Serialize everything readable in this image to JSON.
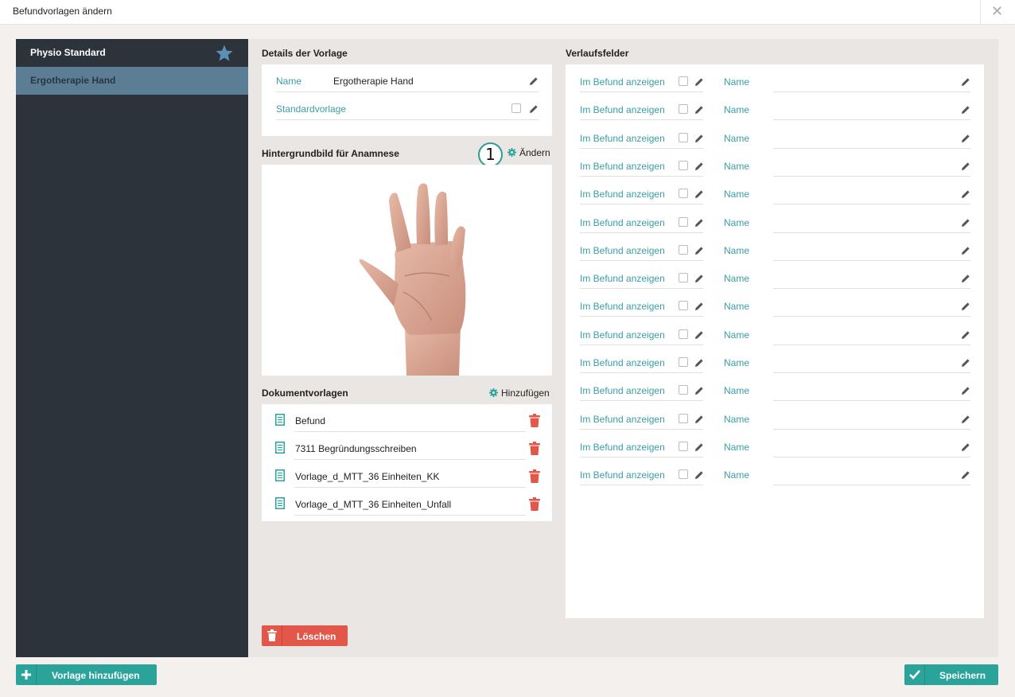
{
  "window": {
    "title": "Befundvorlagen ändern"
  },
  "sidebar": {
    "items": [
      {
        "label": "Physio Standard",
        "starred": true
      },
      {
        "label": "Ergotherapie Hand",
        "selected": true
      }
    ]
  },
  "details": {
    "title": "Details der Vorlage",
    "name_label": "Name",
    "name_value": "Ergotherapie Hand",
    "standard_label": "Standardvorlage"
  },
  "background": {
    "title": "Hintergrundbild für Anamnese",
    "change_label": "Ändern",
    "badge": "1"
  },
  "documents": {
    "title": "Dokumentvorlagen",
    "add_label": "Hinzufügen",
    "items": [
      "Befund",
      "7311 Begründungsschreiben",
      "Vorlage_d_MTT_36 Einheiten_KK",
      "Vorlage_d_MTT_36 Einheiten_Unfall"
    ]
  },
  "delete_button": "Löschen",
  "verlauf": {
    "title": "Verlaufsfelder",
    "rows": [
      {
        "show_label": "Im Befund anzeigen",
        "name_label": "Name"
      },
      {
        "show_label": "Im Befund anzeigen",
        "name_label": "Name"
      },
      {
        "show_label": "Im Befund anzeigen",
        "name_label": "Name"
      },
      {
        "show_label": "Im Befund anzeigen",
        "name_label": "Name"
      },
      {
        "show_label": "Im Befund anzeigen",
        "name_label": "Name"
      },
      {
        "show_label": "Im Befund anzeigen",
        "name_label": "Name"
      },
      {
        "show_label": "Im Befund anzeigen",
        "name_label": "Name"
      },
      {
        "show_label": "Im Befund anzeigen",
        "name_label": "Name"
      },
      {
        "show_label": "Im Befund anzeigen",
        "name_label": "Name"
      },
      {
        "show_label": "Im Befund anzeigen",
        "name_label": "Name"
      },
      {
        "show_label": "Im Befund anzeigen",
        "name_label": "Name"
      },
      {
        "show_label": "Im Befund anzeigen",
        "name_label": "Name"
      },
      {
        "show_label": "Im Befund anzeigen",
        "name_label": "Name"
      },
      {
        "show_label": "Im Befund anzeigen",
        "name_label": "Name"
      },
      {
        "show_label": "Im Befund anzeigen",
        "name_label": "Name"
      }
    ]
  },
  "footer": {
    "add_template_label": "Vorlage hinzufügen",
    "save_label": "Speichern"
  },
  "colors": {
    "accent_teal": "#2aa39b",
    "label_teal": "#3a9ea5",
    "danger_red": "#e3574a",
    "sidebar_dark": "#2d333b",
    "sidebar_selected": "#5b7e95",
    "star_blue": "#5b8fb5"
  },
  "icons": [
    "close-icon",
    "star-icon",
    "pencil-icon",
    "gear-icon",
    "document-icon",
    "trash-icon",
    "plus-icon",
    "check-icon"
  ]
}
